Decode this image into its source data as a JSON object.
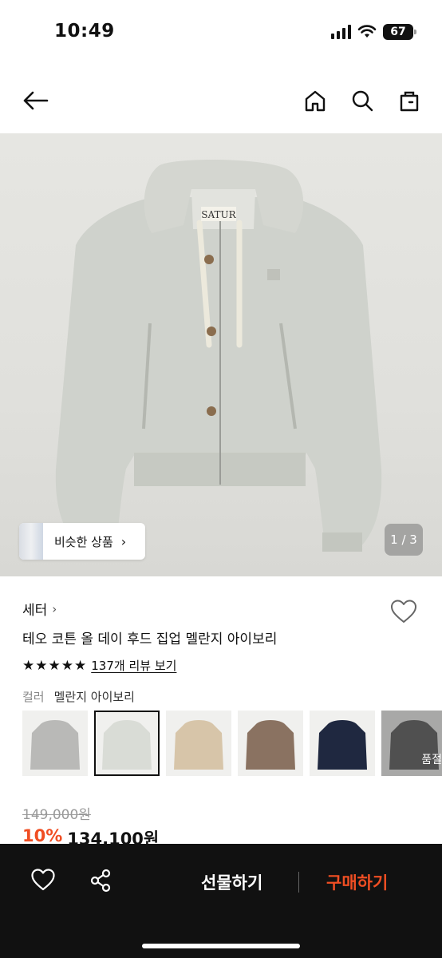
{
  "status_bar": {
    "time": "10:49",
    "battery": "67"
  },
  "nav": {
    "icons": [
      "back-arrow-icon",
      "home-icon",
      "search-icon",
      "shopping-bag-icon"
    ]
  },
  "gallery": {
    "logo_text": "SATUR",
    "similar_label": "비슷한 상품",
    "page_indicator": "1 / 3"
  },
  "product": {
    "category": "세터",
    "title": "테오 코튼 올 데이 후드 집업 멜란지 아이보리",
    "rating_stars": 5,
    "review_link": "137개 리뷰 보기",
    "color_label": "컬러",
    "color_value": "멜란지 아이보리",
    "swatch_colors": [
      "#b9b9b7",
      "#d9dcd6",
      "#d7c5a9",
      "#8a7261",
      "#1f2840",
      "#2e2e2e"
    ],
    "soldout_label": "품절",
    "price_original": "149,000원",
    "discount": "10%",
    "price_sale": "134,100원"
  },
  "bottom_bar": {
    "gift_label": "선물하기",
    "buy_label": "구매하기",
    "icons": [
      "heart-icon",
      "share-icon"
    ],
    "accent_color": "#f04e23"
  }
}
